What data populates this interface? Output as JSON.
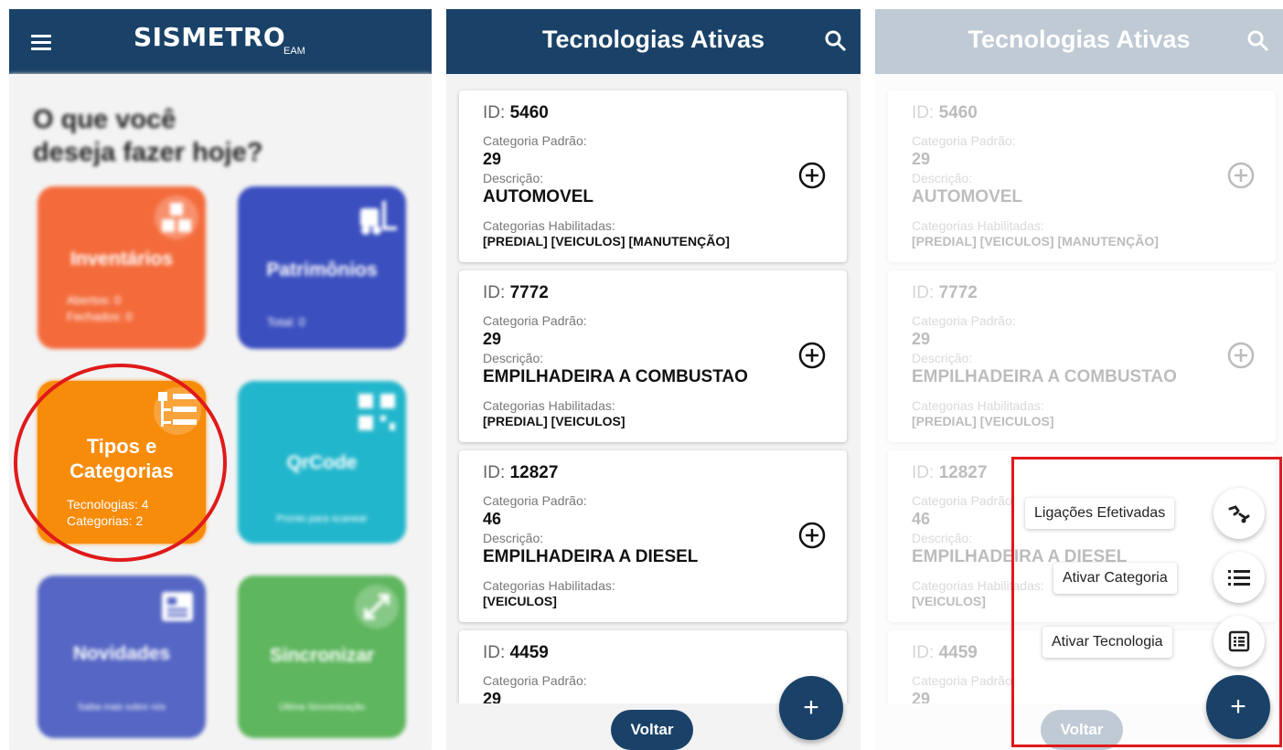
{
  "home": {
    "logo": "SISMETRO",
    "logo_sub": "EAM",
    "greeting_line1": "O que você",
    "greeting_line2": "deseja fazer hoje?",
    "tiles": [
      {
        "title": "Inventários",
        "line1": "Abertos: 0",
        "line2": "Fechados: 0",
        "color": "#f46b3b"
      },
      {
        "title": "Patrimônios",
        "line1": "Total: 0",
        "line2": "",
        "color": "#3b4fbf"
      },
      {
        "title_line1": "Tipos e",
        "title_line2": "Categorias",
        "line1": "Tecnologias: 4",
        "line2": "Categorias: 2",
        "color": "#f78c0b"
      },
      {
        "title": "QrCode",
        "line1": "Pronto para scanear",
        "line2": "",
        "color": "#22b6cc"
      },
      {
        "title": "Novidades",
        "line1": "Saiba mais sobre nós",
        "line2": "",
        "color": "#5566c4"
      },
      {
        "title": "Sincronizar",
        "line1": "Última Sincronização",
        "line2": "",
        "color": "#5eb65e"
      }
    ]
  },
  "list": {
    "title": "Tecnologias Ativas",
    "id_label": "ID:",
    "cat_label": "Categoria Padrão:",
    "desc_label": "Descrição:",
    "hab_label": "Categorias Habilitadas:",
    "items": [
      {
        "id": "5460",
        "categoria": "29",
        "descricao": "AUTOMOVEL",
        "habilitadas": "[PREDIAL] [VEICULOS] [MANUTENÇÃO]"
      },
      {
        "id": "7772",
        "categoria": "29",
        "descricao": "EMPILHADEIRA A COMBUSTAO",
        "habilitadas": "[PREDIAL] [VEICULOS]"
      },
      {
        "id": "12827",
        "categoria": "46",
        "descricao": "EMPILHADEIRA A DIESEL",
        "habilitadas": "[VEICULOS]"
      },
      {
        "id": "4459",
        "categoria": "29",
        "descricao": "",
        "habilitadas": ""
      }
    ],
    "voltar": "Voltar",
    "fab_symbol": "+"
  },
  "menu": {
    "items": [
      {
        "label": "Ligações Efetivadas",
        "icon": "link-icon"
      },
      {
        "label": "Ativar Categoria",
        "icon": "list-icon"
      },
      {
        "label": "Ativar Tecnologia",
        "icon": "clipboard-list-icon"
      }
    ],
    "fab_symbol": "+"
  },
  "colors": {
    "primary": "#1a4268",
    "highlight": "#e01a1a",
    "tile_tipos": "#f78c0b"
  }
}
